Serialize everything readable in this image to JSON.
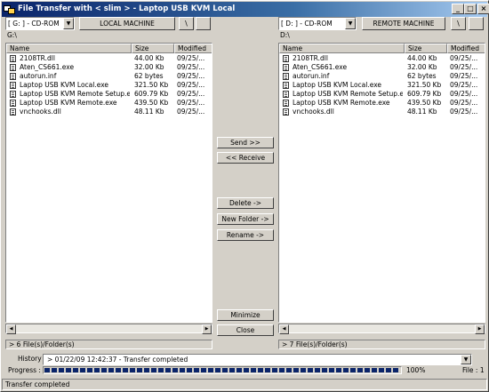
{
  "window": {
    "title": "File Transfer with < slim > - Laptop USB KVM Local",
    "controls": {
      "minimize": "_",
      "maximize": "□",
      "close": "×"
    }
  },
  "local": {
    "drive": "[ G: ] - CD-ROM",
    "machine_label": "LOCAL MACHINE",
    "root_button": "\\",
    "path": "G:\\",
    "columns": [
      "Name",
      "Size",
      "Modified"
    ],
    "files": [
      {
        "name": "2108TR.dll",
        "size": "44.00 Kb",
        "modified": "09/25/..."
      },
      {
        "name": "Aten_CS661.exe",
        "size": "32.00 Kb",
        "modified": "09/25/..."
      },
      {
        "name": "autorun.inf",
        "size": "62 bytes",
        "modified": "09/25/..."
      },
      {
        "name": "Laptop USB KVM Local.exe",
        "size": "321.50 Kb",
        "modified": "09/25/..."
      },
      {
        "name": "Laptop USB KVM Remote Setup.exe",
        "size": "609.79 Kb",
        "modified": "09/25/..."
      },
      {
        "name": "Laptop USB KVM Remote.exe",
        "size": "439.50 Kb",
        "modified": "09/25/..."
      },
      {
        "name": "vnchooks.dll",
        "size": "48.11 Kb",
        "modified": "09/25/..."
      }
    ],
    "count": "> 6 File(s)/Folder(s)"
  },
  "remote": {
    "drive": "[ D: ] - CD-ROM",
    "machine_label": "REMOTE MACHINE",
    "root_button": "\\",
    "path": "D:\\",
    "columns": [
      "Name",
      "Size",
      "Modified"
    ],
    "files": [
      {
        "name": "2108TR.dll",
        "size": "44.00 Kb",
        "modified": "09/25/..."
      },
      {
        "name": "Aten_CS661.exe",
        "size": "32.00 Kb",
        "modified": "09/25/..."
      },
      {
        "name": "autorun.inf",
        "size": "62 bytes",
        "modified": "09/25/..."
      },
      {
        "name": "Laptop USB KVM Local.exe",
        "size": "321.50 Kb",
        "modified": "09/25/..."
      },
      {
        "name": "Laptop USB KVM Remote Setup.exe",
        "size": "609.79 Kb",
        "modified": "09/25/..."
      },
      {
        "name": "Laptop USB KVM Remote.exe",
        "size": "439.50 Kb",
        "modified": "09/25/..."
      },
      {
        "name": "vnchooks.dll",
        "size": "48.11 Kb",
        "modified": "09/25/..."
      }
    ],
    "count": "> 7 File(s)/Folder(s)"
  },
  "actions": {
    "send": "Send >>",
    "receive": "<< Receive",
    "delete": "Delete ->",
    "new_folder": "New Folder ->",
    "rename": "Rename ->",
    "minimize": "Minimize",
    "close": "Close"
  },
  "history": {
    "label": "History :",
    "value": "> 01/22/09 12:42:37 - Transfer completed"
  },
  "progress": {
    "label": "Progress :",
    "percent_text": "100%",
    "fraction": 1.0,
    "file_text": "File : 1"
  },
  "status": "Transfer completed",
  "colors": {
    "titlebar_start": "#0a246a",
    "progress": "#0a246a",
    "face": "#d4d0c8"
  }
}
